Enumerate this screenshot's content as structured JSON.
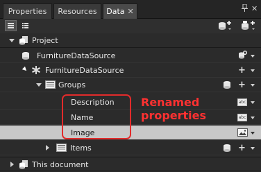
{
  "tabs": [
    {
      "label": "Properties"
    },
    {
      "label": "Resources"
    },
    {
      "label": "Data",
      "active": true,
      "close_glyph": "✕"
    }
  ],
  "window_controls": {
    "pin_glyph": "❖",
    "close_glyph": "✕"
  },
  "toolbar": {
    "list_view_icon": "list-view-icon",
    "details_view_icon": "details-view-icon",
    "add_data_source_icon": "add-data-source-icon",
    "create_sample_data_icon": "create-sample-data-icon"
  },
  "tree": {
    "project_header": "Project",
    "data_source_root": "FurnitureDataSource",
    "data_source_child": "FurnitureDataSource",
    "groups": "Groups",
    "properties": [
      {
        "label": "Description",
        "type_icon": "abc"
      },
      {
        "label": "Name",
        "type_icon": "abc"
      },
      {
        "label": "Image",
        "type_icon": "image",
        "selected": true
      }
    ],
    "items": "Items",
    "document_header": "This document"
  },
  "annotation": {
    "text_line1": "Renamed",
    "text_line2": "properties",
    "color": "#e22b2b"
  },
  "colors": {
    "background": "#2b2b2b",
    "selected_row": "#c8c8c8",
    "annotation": "#ff3131"
  }
}
